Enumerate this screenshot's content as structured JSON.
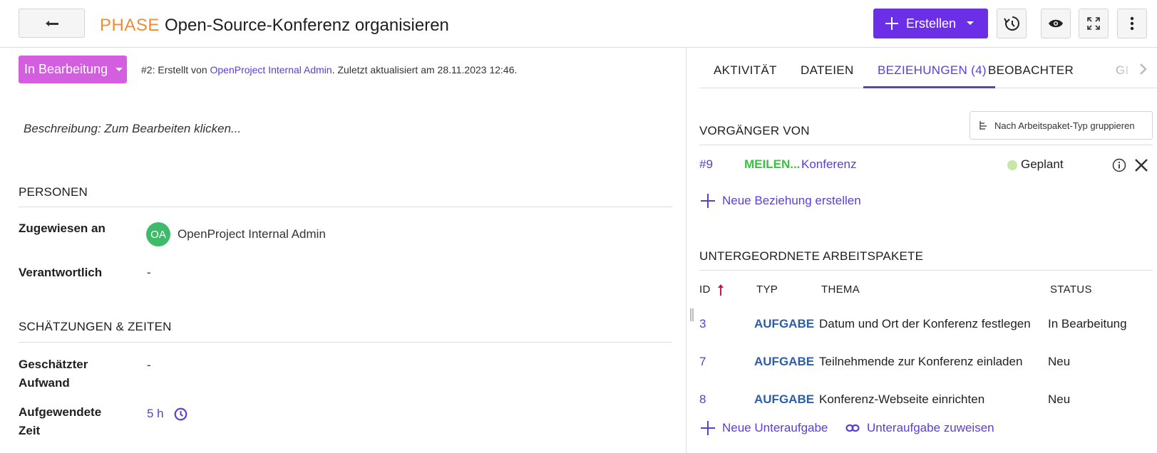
{
  "header": {
    "type": "PHASE",
    "subject": "Open-Source-Konferenz organisieren",
    "create_label": "Erstellen"
  },
  "status": {
    "label": "In Bearbeitung"
  },
  "meta": {
    "prefix": "#2: Erstellt von ",
    "author": "OpenProject Internal Admin",
    "suffix": ". Zuletzt aktualisiert am 28.11.2023 12:46."
  },
  "description": "Beschreibung: Zum Bearbeiten klicken...",
  "personen": {
    "title": "PERSONEN",
    "assignee_label": "Zugewiesen an",
    "assignee_initials": "OA",
    "assignee_name": "OpenProject Internal Admin",
    "responsible_label": "Verantwortlich",
    "responsible_value": "-"
  },
  "estimates": {
    "title": "SCHÄTZUNGEN & ZEITEN",
    "estimated_label_1": "Geschätzter",
    "estimated_label_2": "Aufwand",
    "estimated_value": "-",
    "spent_label_1": "Aufgewendete",
    "spent_label_2": "Zeit",
    "spent_value": "5 h"
  },
  "tabs": [
    {
      "label": "AKTIVITÄT"
    },
    {
      "label": "DATEIEN"
    },
    {
      "label": "BEZIEHUNGEN (4)"
    },
    {
      "label": "BEOBACHTER"
    },
    {
      "label": "GI"
    }
  ],
  "relations": {
    "group_button": "Nach Arbeitspaket-Typ gruppieren",
    "predecessor_title": "VORGÄNGER VON",
    "item": {
      "id": "#9",
      "type": "MEILEN...",
      "subject": "Konferenz",
      "status": "Geplant",
      "status_color": "#c5e8a4"
    },
    "new_relation": "Neue Beziehung erstellen"
  },
  "children": {
    "title": "UNTERGEORDNETE ARBEITSPAKETE",
    "columns": [
      "ID",
      "TYP",
      "THEMA",
      "STATUS"
    ],
    "rows": [
      {
        "id": "3",
        "type": "AUFGABE",
        "subject": "Datum und Ort der Konferenz festlegen",
        "status": "In Bearbeitung"
      },
      {
        "id": "7",
        "type": "AUFGABE",
        "subject": "Teilnehmende zur Konferenz einladen",
        "status": "Neu"
      },
      {
        "id": "8",
        "type": "AUFGABE",
        "subject": "Konferenz-Webseite einrichten",
        "status": "Neu"
      }
    ],
    "new_child": "Neue Unteraufgabe",
    "assign_child": "Unteraufgabe zuweisen"
  },
  "colors": {
    "accent": "#6c2fe8",
    "link": "#5b3fd0",
    "type_phase": "#f08c35",
    "status_in_progress": "#d35fe0",
    "type_milestone": "#35c53f",
    "type_task": "#2c5ea8"
  }
}
